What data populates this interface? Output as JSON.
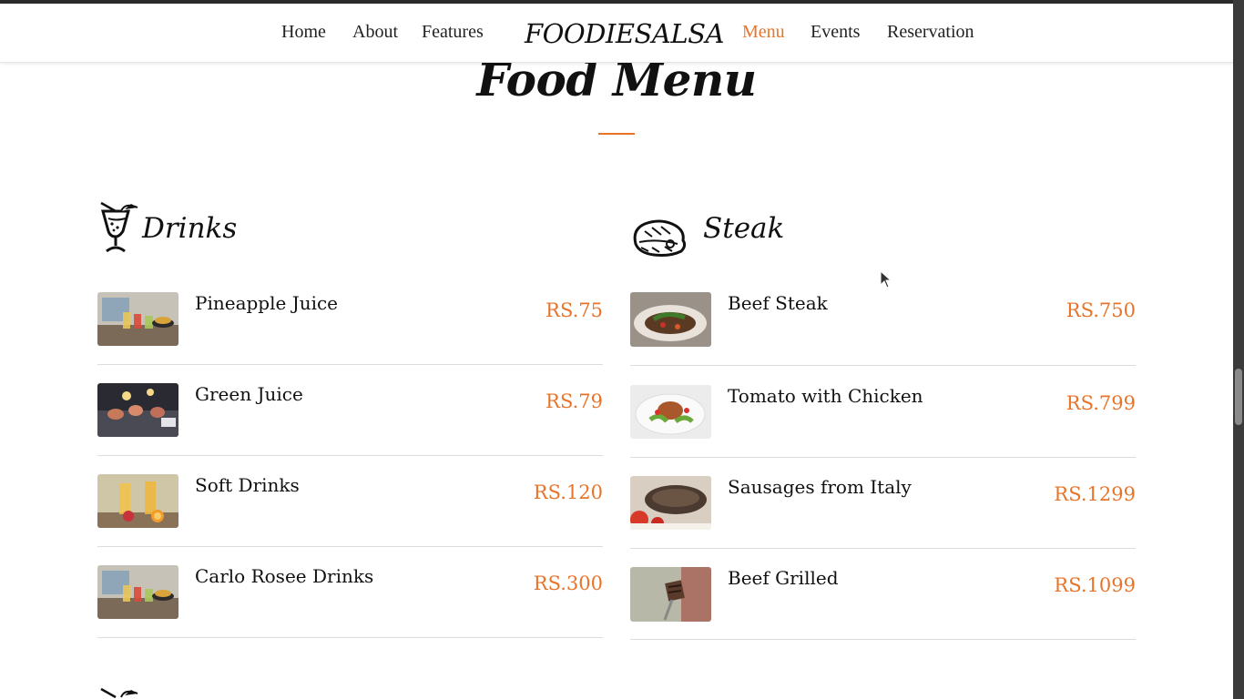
{
  "nav": {
    "brand": "FOODIESALSA",
    "links": [
      "Home",
      "About",
      "Features",
      "Menu",
      "Events",
      "Reservation"
    ],
    "active": "Menu"
  },
  "section": {
    "title": "Food Menu"
  },
  "colors": {
    "accent": "#e8742a",
    "text": "#111111",
    "divider": "#dcdcdc"
  },
  "categories": [
    {
      "title": "Drinks",
      "icon": "cocktail-glass-icon",
      "items": [
        {
          "name": "Pineapple Juice",
          "price": "RS.75",
          "thumb": "drinks-table-photo"
        },
        {
          "name": "Green Juice",
          "price": "RS.79",
          "thumb": "candlelit-glasses-photo"
        },
        {
          "name": "Soft Drinks",
          "price": "RS.120",
          "thumb": "juice-glasses-photo"
        },
        {
          "name": "Carlo Rosee Drinks",
          "price": "RS.300",
          "thumb": "drinks-table-photo"
        }
      ]
    },
    {
      "title": "Steak",
      "icon": "steak-icon",
      "items": [
        {
          "name": "Beef Steak",
          "price": "RS.750",
          "thumb": "steak-plate-photo"
        },
        {
          "name": "Tomato with Chicken",
          "price": "RS.799",
          "thumb": "chicken-salad-photo"
        },
        {
          "name": "Sausages from Italy",
          "price": "RS.1299",
          "thumb": "meat-tomato-photo"
        },
        {
          "name": "Beef Grilled",
          "price": "RS.1099",
          "thumb": "grilled-beef-fork-photo"
        }
      ]
    }
  ]
}
